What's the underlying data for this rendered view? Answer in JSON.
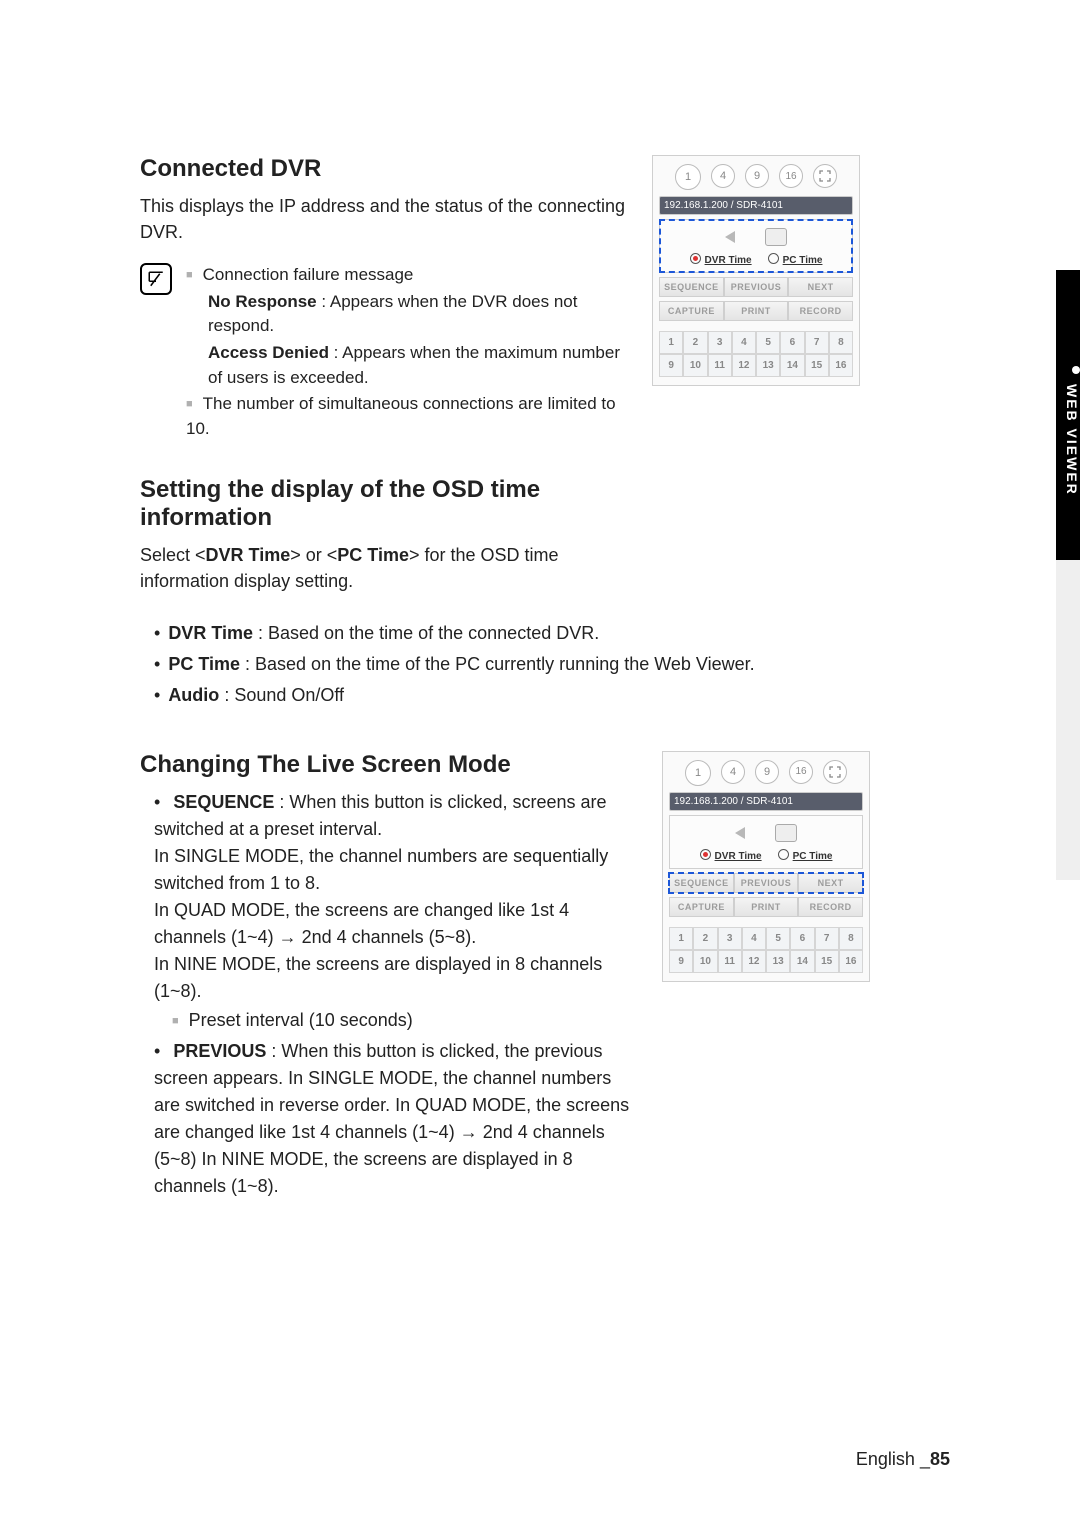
{
  "side_tab": "WEB VIEWER",
  "footer": {
    "lang": "English",
    "sep": "_",
    "page": "85"
  },
  "section1": {
    "heading": "Connected DVR",
    "lead": "This displays the IP address and the status of the connecting DVR.",
    "note_item1": "Connection failure message",
    "note_sub1_b": "No Response",
    "note_sub1_t": " : Appears when the DVR does not respond.",
    "note_sub2_b": "Access Denied",
    "note_sub2_t": " : Appears when the maximum number of users is exceeded.",
    "note_item2": "The number of simultaneous connections are limited to 10."
  },
  "section2": {
    "heading": "Setting the display of the OSD time information",
    "lead_a": "Select <",
    "lead_b1": "DVR Time",
    "lead_mid": "> or <",
    "lead_b2": "PC Time",
    "lead_c": "> for the OSD time information display setting.",
    "b1": "DVR Time",
    "b1t": " : Based on the time of the connected DVR.",
    "b2": "PC Time",
    "b2t": " : Based on the time of the PC currently running the Web Viewer.",
    "b3": "Audio",
    "b3t": " : Sound On/Off"
  },
  "section3": {
    "heading": "Changing The Live Screen Mode",
    "seq_b": "SEQUENCE",
    "seq_1": " : When this button is clicked, screens are switched at a preset interval.",
    "seq_2": "In SINGLE MODE, the channel numbers are sequentially switched from 1 to 8.",
    "seq_3": "In QUAD MODE, the screens are changed like 1st 4 channels (1~4) → 2nd 4 channels (5~8).",
    "seq_4": "In NINE MODE, the screens are displayed in 8 channels (1~8).",
    "seq_sub": "Preset interval (10 seconds)",
    "prev_b": "PREVIOUS",
    "prev_t": " : When this button is clicked, the previous screen appears. In SINGLE MODE, the channel numbers are switched in reverse order. In QUAD MODE, the screens are changed like 1st 4 channels (1~4) → 2nd 4 channels (5~8)  In NINE MODE, the screens are displayed in 8 channels (1~8)."
  },
  "panel": {
    "circles": [
      "1",
      "4",
      "9",
      "16",
      ""
    ],
    "status_ip": "192.168.1.200",
    "status_sep": "   / ",
    "status_model": "SDR-4101",
    "dvr_time": "DVR Time",
    "pc_time": "PC Time",
    "btns1": [
      "SEQUENCE",
      "PREVIOUS",
      "NEXT"
    ],
    "btns2": [
      "CAPTURE",
      "PRINT",
      "RECORD"
    ],
    "cells": [
      "1",
      "2",
      "3",
      "4",
      "5",
      "6",
      "7",
      "8",
      "9",
      "10",
      "11",
      "12",
      "13",
      "14",
      "15",
      "16"
    ]
  }
}
